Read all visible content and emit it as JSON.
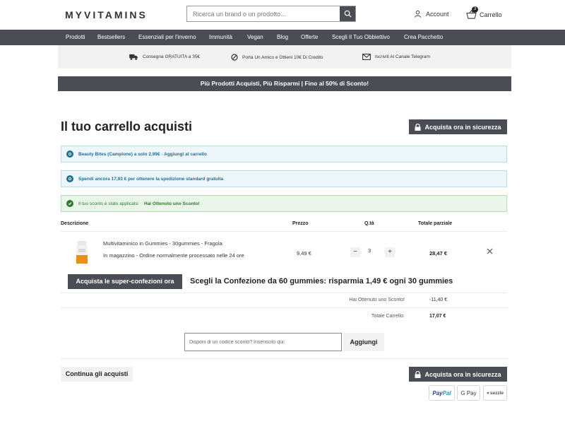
{
  "header": {
    "logo": "MYVITAMINS",
    "search_placeholder": "Ricerca un brand o un prodotto...",
    "account_label": "Account",
    "cart_label": "Carrello",
    "cart_count": "3"
  },
  "nav": {
    "items": [
      "Prodotti",
      "Bestsellers",
      "Essenziali per l'inverno",
      "Immunità",
      "Vegan",
      "Blog",
      "Offerte",
      "Scegli Il Tuo Obbiettivo",
      "Crea Pacchetto"
    ]
  },
  "benefits": [
    {
      "icon": "truck-icon",
      "label": "Consegna GRATUITA a 35€"
    },
    {
      "icon": "no-sign-icon",
      "label": "Porta Un Amico e Ottieni 10€ Di Credito"
    },
    {
      "icon": "mail-icon",
      "label": "Iscriviti Al Canale Telegram"
    }
  ],
  "promo_banner": "Più Prodotti Acquisti, Più Risparmi | Fino al 50% di Sconto!",
  "page": {
    "title": "Il tuo carrello acquisti",
    "secure_checkout_label": "Acquista ora in sicurezza"
  },
  "notices": {
    "sample_offer": "Beauty Bites (Campione) a solo 2.99€ - Aggiungi al carrello",
    "shipping": "Spendi ancora 17,93 € per ottenere la spedizione standard gratuita",
    "discount_prefix": "Il tuo sconto è stato applicato:",
    "discount_name": "Hai Ottenuto uno Sconto!"
  },
  "table": {
    "headers": {
      "description": "Descrizione",
      "price": "Prezzo",
      "quantity": "Q.tà",
      "subtotal": "Totale parziale"
    }
  },
  "item": {
    "name": "Multivitaminico in Gummies - 30gummies - Fragola",
    "stock": "In magazzino  -  Ordine normalmente processato nelle 24 ore",
    "price": "9,49 €",
    "quantity": "3",
    "line_total": "28,47 €"
  },
  "bundle": {
    "button_label": "Acquista le super-confezioni ora",
    "text": "Scegli la Confezione da 60 gummies: risparmia 1,49 € ogni 30 gummies"
  },
  "summary": {
    "discount_label": "Hai Ottenuto uno Sconto!",
    "discount_value": "-11,40 €",
    "total_label": "Totale Carrello:",
    "total_value": "17,07 €"
  },
  "discount_code": {
    "placeholder": "Disponi di un codice sconto? Inseriscilo qui:",
    "apply_label": "Aggiungi"
  },
  "footer": {
    "continue_label": "Continua gli acquisti",
    "secure_checkout_label": "Acquista ora in sicurezza",
    "payments": {
      "paypal_pay": "Pay",
      "paypal_pal": "Pal",
      "gpay": "G Pay",
      "sezzle": "sezzle"
    }
  },
  "colors": {
    "dark_bar": "#4a4d54",
    "info_text": "#1f6f95",
    "success_text": "#2b7a25"
  }
}
